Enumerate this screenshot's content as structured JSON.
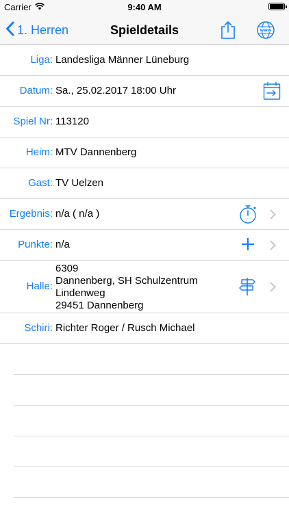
{
  "status": {
    "carrier": "Carrier",
    "time": "9:40 AM"
  },
  "nav": {
    "back_label": "1. Herren",
    "title": "Spieldetails"
  },
  "rows": {
    "liga": {
      "label": "Liga:",
      "value": "Landesliga Männer Lüneburg"
    },
    "datum": {
      "label": "Datum:",
      "value": "Sa., 25.02.2017 18:00 Uhr"
    },
    "spielnr": {
      "label": "Spiel Nr:",
      "value": "113120"
    },
    "heim": {
      "label": "Heim:",
      "value": "MTV Dannenberg"
    },
    "gast": {
      "label": "Gast:",
      "value": "TV Uelzen"
    },
    "ergebnis": {
      "label": "Ergebnis:",
      "value": "n/a  ( n/a )"
    },
    "punkte": {
      "label": "Punkte:",
      "value": "n/a"
    },
    "halle": {
      "label": "Halle:",
      "lines": [
        "6309",
        "Dannenberg, SH Schulzentrum",
        "Lindenweg",
        "29451 Dannenberg"
      ]
    },
    "schiri": {
      "label": "Schiri:",
      "value": "Richter Roger / Rusch Michael"
    }
  },
  "icons": {
    "back": "chevron-left-icon",
    "share": "share-icon",
    "web": "globe-www-icon",
    "calendar": "calendar-export-icon",
    "stopwatch": "stopwatch-icon",
    "plus": "plus-icon",
    "signpost": "signpost-icon",
    "disclosure": "chevron-right-icon"
  },
  "colors": {
    "accent": "#147efb",
    "separator": "#d9d9de",
    "chevron": "#c7c7cc",
    "bar": "#f7f7f7"
  }
}
